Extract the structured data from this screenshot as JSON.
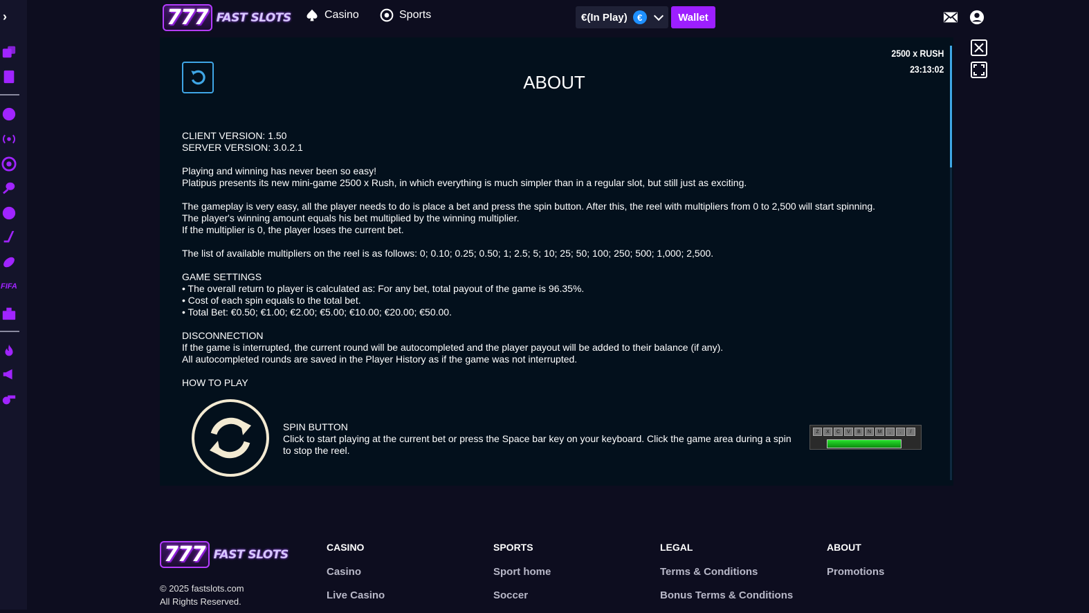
{
  "brand": {
    "logo_numbers": "777",
    "logo_word": "FAST SLOTS"
  },
  "nav": [
    {
      "label": "Casino",
      "icon": "spade-icon"
    },
    {
      "label": "Sports",
      "icon": "soccer-ball-icon"
    }
  ],
  "header": {
    "balance_label": "€(In Play)",
    "currency_symbol": "€",
    "wallet_label": "Wallet"
  },
  "game": {
    "name": "2500 x RUSH",
    "clock": "23:13:02",
    "title": "ABOUT",
    "paragraphs": [
      [
        "CLIENT VERSION: 1.50",
        "SERVER VERSION: 3.0.2.1"
      ],
      [
        "Playing and winning has never been so easy!",
        "Platipus presents its new mini-game 2500 x Rush, in which everything is much simpler than in a regular slot, but still just as exciting."
      ],
      [
        "The gameplay is very easy, all the player needs to do is place a bet and press the spin button. After this, the reel with multipliers from 0 to 2,500 will start spinning.",
        "The player's winning amount equals his bet multiplied by the winning multiplier.",
        "If the multiplier is 0, the player loses the current bet."
      ],
      [
        "The list of available multipliers on the reel is as follows: 0; 0.10; 0.25; 0.50; 1; 2.5; 5; 10; 25; 50; 100; 250; 500; 1,000; 2,500."
      ],
      [
        "GAME SETTINGS",
        "• The overall return to player is calculated as: For any bet, total payout of the game is 96.35%.",
        "• Cost of each spin equals to the total bet.",
        "• Total Bet: €0.50; €1.00; €2.00; €5.00; €10.00; €20.00; €50.00."
      ],
      [
        "DISCONNECTION",
        "If the game is interrupted, the current round will be autocompleted and the player payout will be added to their balance (if any).",
        "All autocompleted rounds are saved in the Player History as if the game was not interrupted."
      ],
      [
        "HOW TO PLAY"
      ]
    ],
    "spin_title": "SPIN BUTTON",
    "spin_desc": "Click to start playing at the current bet or press the Space bar key on your keyboard. Click the game area during a spin to stop the reel.",
    "keyboard_keys": [
      "Z",
      "X",
      "C",
      "V",
      "B",
      "N",
      "M",
      ",",
      ".",
      "/"
    ]
  },
  "footer": {
    "copyright": "© 2025 fastslots.com",
    "rights": "All Rights Reserved.",
    "columns": [
      {
        "title": "CASINO",
        "links": [
          "Casino",
          "Live Casino"
        ]
      },
      {
        "title": "SPORTS",
        "links": [
          "Sport home",
          "Soccer"
        ]
      },
      {
        "title": "LEGAL",
        "links": [
          "Terms & Conditions",
          "Bonus Terms & Conditions"
        ]
      },
      {
        "title": "ABOUT",
        "links": [
          "Promotions"
        ]
      }
    ]
  },
  "sidebar": {
    "fifa_label": "FIFA",
    "icons": [
      "casino-games-icon",
      "cards-icon",
      "sports-icon",
      "live-icon",
      "soccer-icon",
      "tennis-icon",
      "basketball-icon",
      "hockey-icon",
      "football-icon",
      "esports-icon",
      "promotions-icon",
      "fire-icon",
      "megaphone-icon",
      "whistle-icon"
    ]
  },
  "colors": {
    "accent": "#9d1fff",
    "panel_bg": "#03101c",
    "link_blue": "#3fa6e6"
  }
}
